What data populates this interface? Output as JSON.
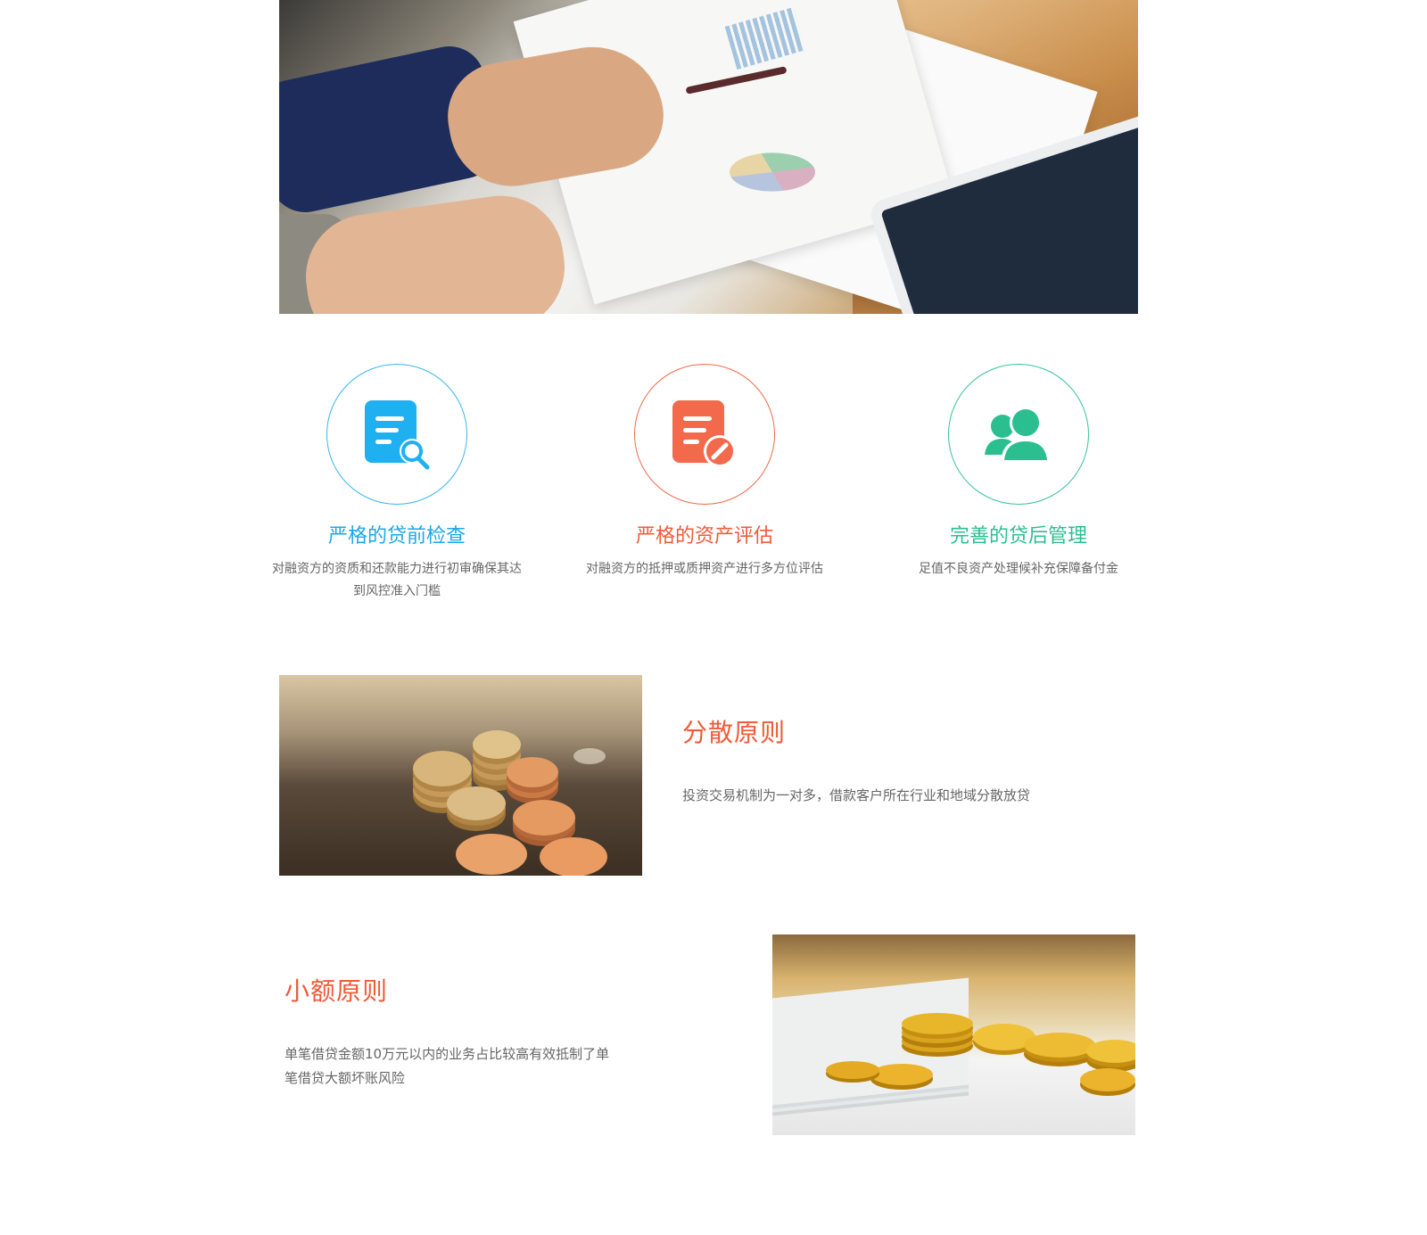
{
  "features": [
    {
      "title": "严格的贷前检查",
      "desc": "对融资方的资质和还款能力进行初审确保其达到风控准入门槛",
      "icon": "document-search-icon",
      "color": "#1ba8e8"
    },
    {
      "title": "严格的资产评估",
      "desc": "对融资方的抵押或质押资产进行多方位评估",
      "icon": "document-edit-icon",
      "color": "#f05a38"
    },
    {
      "title": "完善的贷后管理",
      "desc": "足值不良资产处理候补充保障备付金",
      "icon": "users-icon",
      "color": "#2bbf8f"
    }
  ],
  "principles": [
    {
      "title": "分散原则",
      "desc": "投资交易机制为一对多，借款客户所在行业和地域分散放贷"
    },
    {
      "title": "小额原则",
      "desc": "单笔借贷金额10万元以内的业务占比较高有效抵制了单笔借贷大额坏账风险"
    }
  ],
  "colors": {
    "accent_orange": "#f05a38",
    "accent_blue": "#1ba8e8",
    "accent_green": "#2bbf8f",
    "body_text": "#666666"
  }
}
